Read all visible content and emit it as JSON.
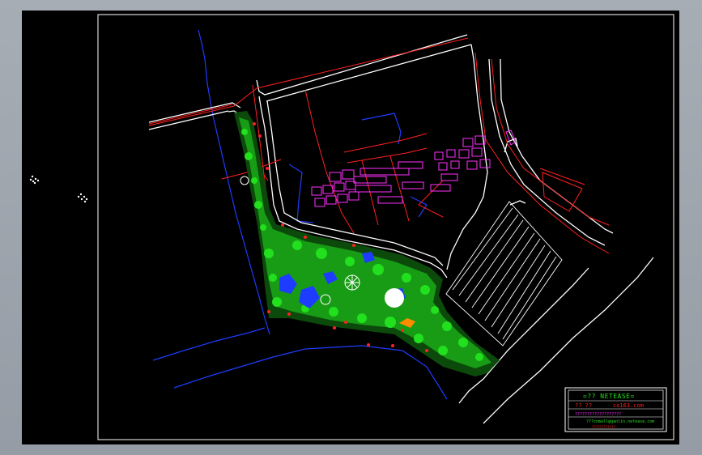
{
  "title_block": {
    "header": "=?? NETEASE=",
    "line2_left": "?? ??",
    "line2_right": "co163.com",
    "line3": "???????????????????",
    "line4": "???cnmall@ganlin.netease.com",
    "line5": "????????????"
  },
  "colors": {
    "sheet_border": "#ffffff",
    "road": "#ffffff",
    "red_lines": "#ff2020",
    "water": "#1e3cff",
    "vegetation": "#22e01e",
    "buildings": "#ff30ff",
    "title_text_green": "#22e01e",
    "title_text_red": "#ff2020"
  }
}
